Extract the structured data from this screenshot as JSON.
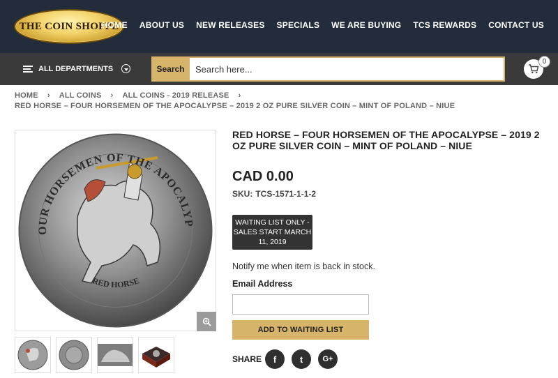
{
  "header": {
    "logo_text": "THE COIN SHOPPE",
    "nav": [
      "HOME",
      "ABOUT US",
      "NEW RELEASES",
      "SPECIALS",
      "WE ARE BUYING",
      "TCS REWARDS",
      "CONTACT US"
    ]
  },
  "subbar": {
    "departments_label": "ALL DEPARTMENTS",
    "search_button": "Search",
    "search_placeholder": "Search here...",
    "cart_count": "0"
  },
  "breadcrumb": {
    "items": [
      "HOME",
      "ALL COINS",
      "ALL COINS - 2019 RELEASE"
    ],
    "current": "RED HORSE – FOUR HORSEMEN OF THE APOCALYPSE – 2019 2 OZ PURE SILVER COIN – MINT OF POLAND – NIUE"
  },
  "product": {
    "title": "RED HORSE – FOUR HORSEMEN OF THE APOCALYPSE – 2019 2 OZ PURE SILVER COIN – MINT OF POLAND – NIUE",
    "price": "CAD 0.00",
    "sku_label": "SKU:",
    "sku_value": "TCS-1571-1-1-2",
    "waiting_badge": "WAITING LIST ONLY - SALES START MARCH 11, 2019",
    "notify_text": "Notify me when item is back in stock.",
    "email_label": "Email Address",
    "email_value": "",
    "add_button": "ADD TO WAITING LIST",
    "share_label": "SHARE",
    "coin_legend_top": "FOUR HORSEMEN OF THE APOCALYPSE",
    "coin_legend_bottom": "RED HORSE"
  },
  "social": [
    {
      "icon": "facebook-icon",
      "glyph": "f"
    },
    {
      "icon": "twitter-icon",
      "glyph": "t"
    },
    {
      "icon": "google-plus-icon",
      "glyph": "G+"
    }
  ],
  "colors": {
    "header_bg": "#222c3a",
    "subbar_bg": "#3a3a3a",
    "accent_gold": "#d6b46a",
    "badge_bg": "#333333"
  }
}
